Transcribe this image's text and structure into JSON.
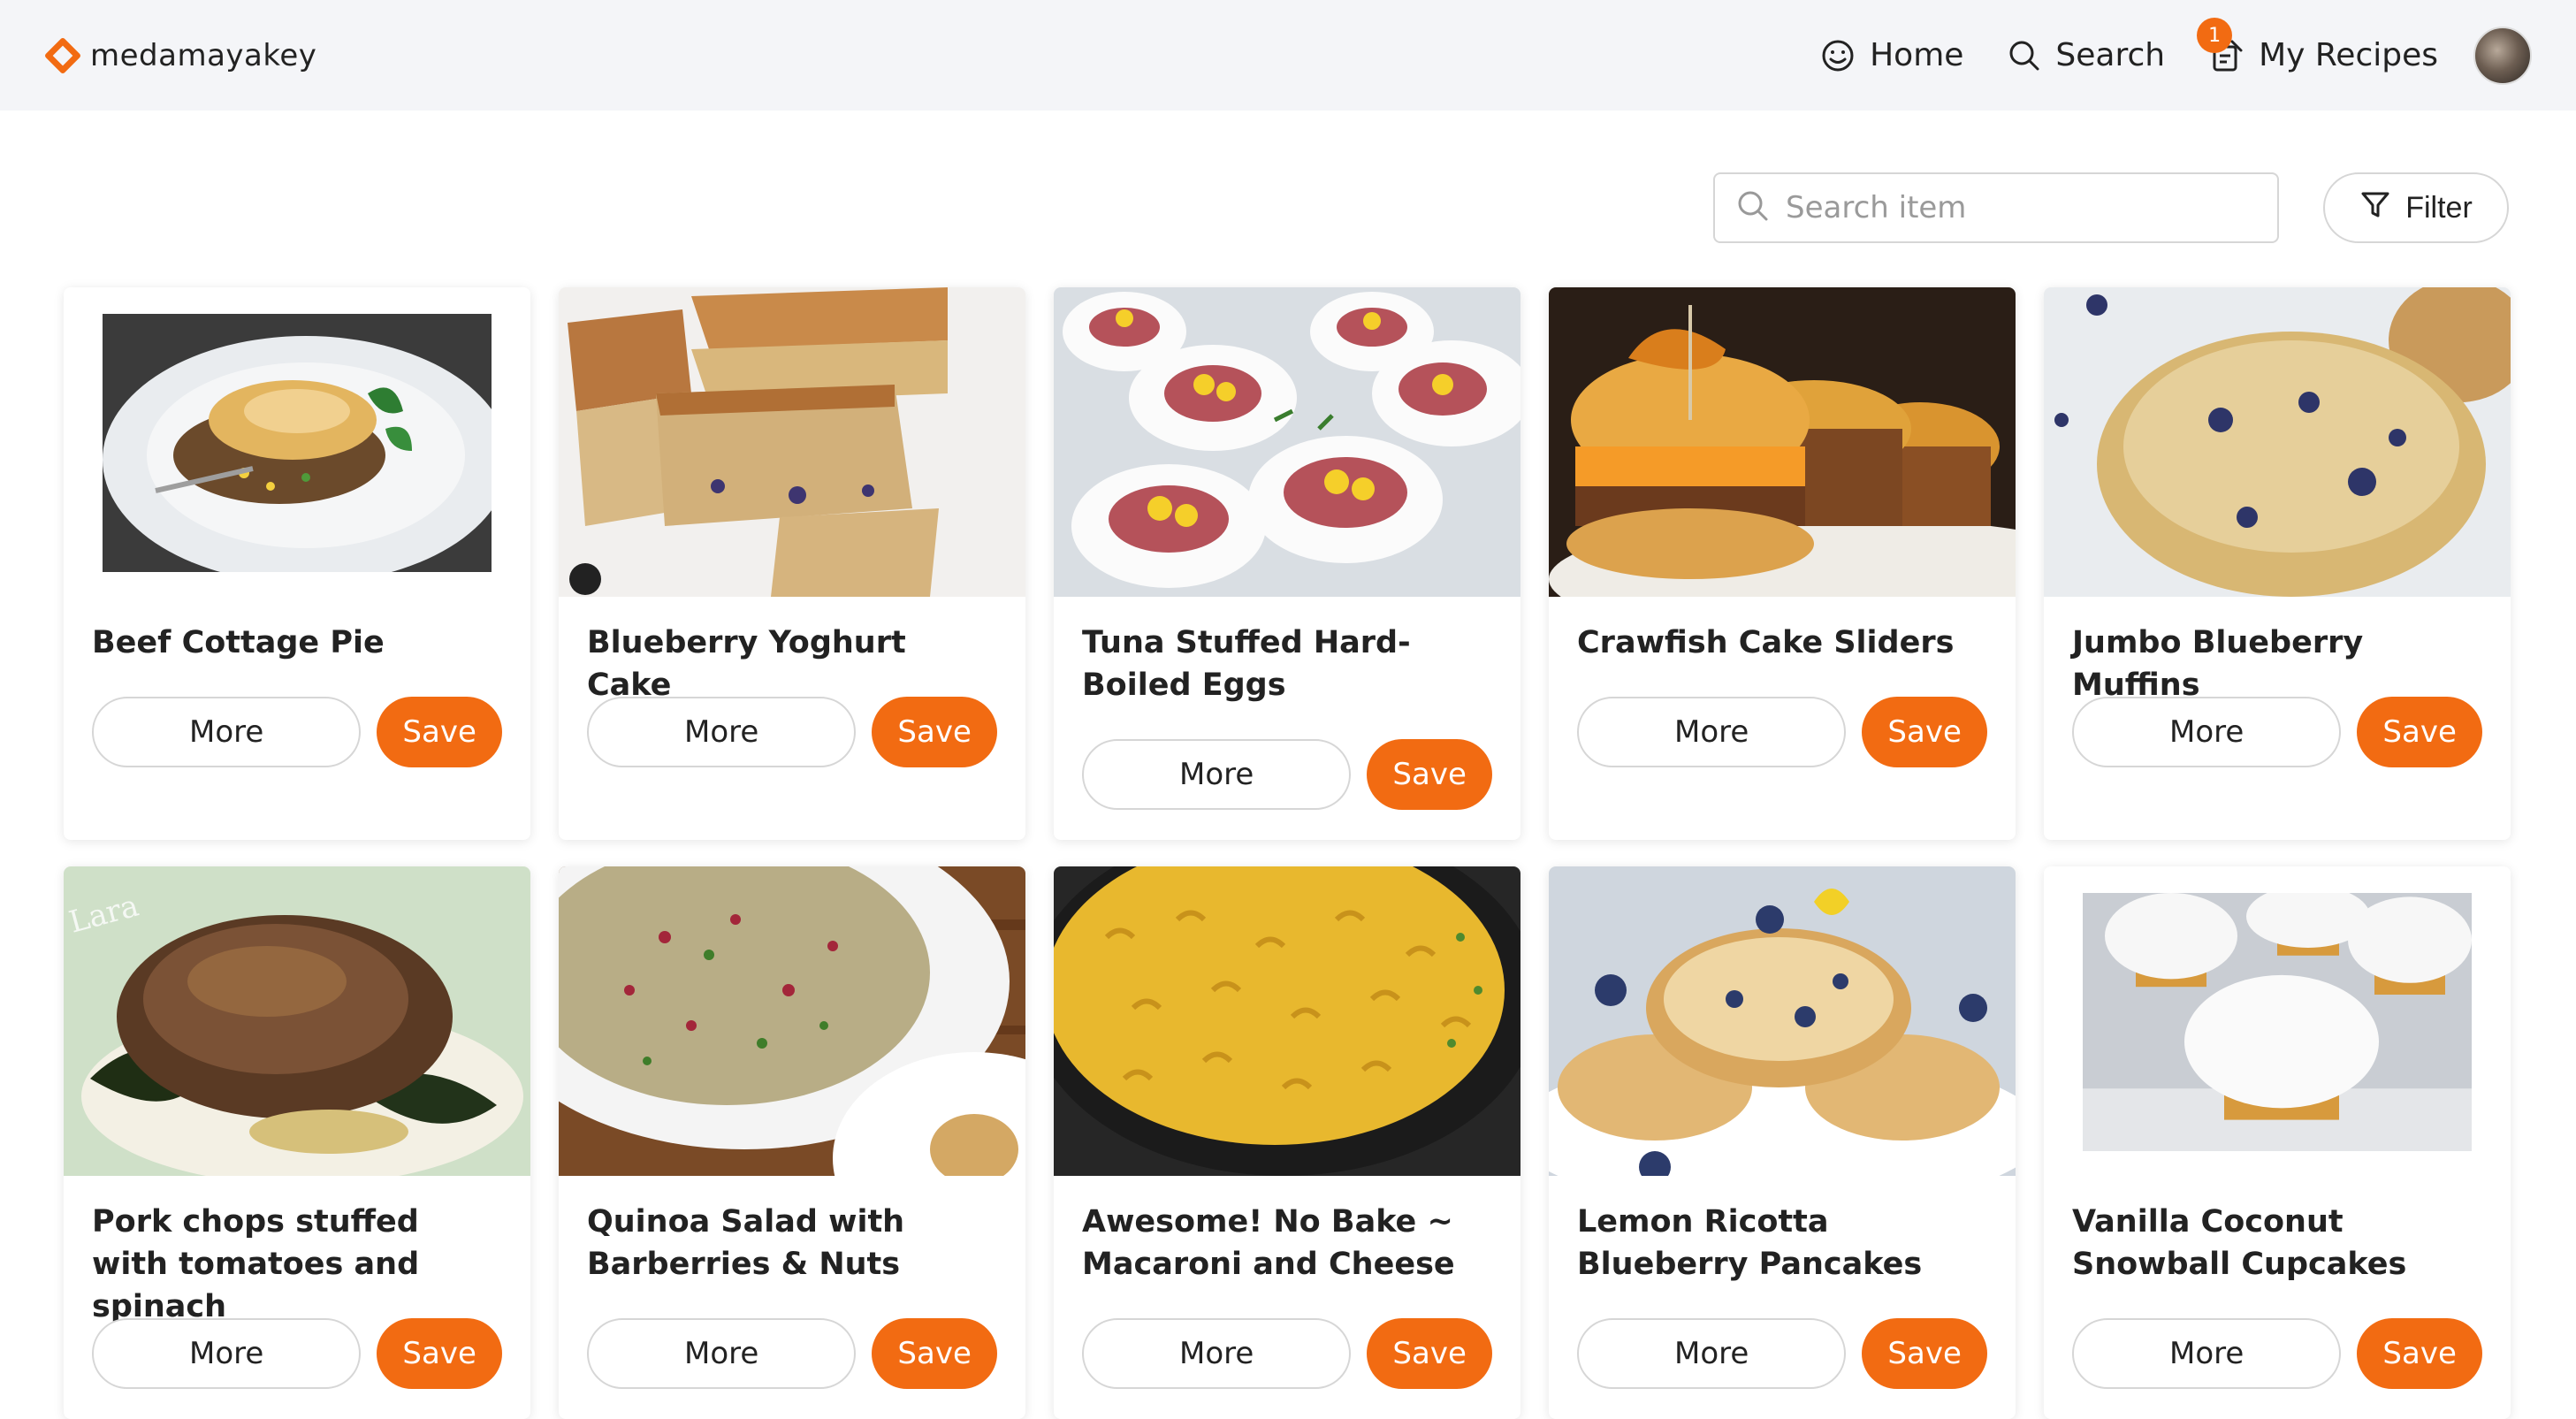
{
  "brand": {
    "name": "medamayakey",
    "accent": "#f26b12"
  },
  "nav": {
    "home": "Home",
    "search": "Search",
    "my_recipes": "My Recipes",
    "my_recipes_badge": "1"
  },
  "toolbar": {
    "search_placeholder": "Search item",
    "filter_label": "Filter"
  },
  "buttons": {
    "more": "More",
    "save": "Save"
  },
  "recipes": [
    {
      "title": "Beef Cottage Pie",
      "image": "cottage-pie"
    },
    {
      "title": "Blueberry Yoghurt Cake",
      "image": "yoghurt-cake"
    },
    {
      "title": "Tuna Stuffed Hard-Boiled Eggs",
      "image": "stuffed-eggs"
    },
    {
      "title": "Crawfish Cake Sliders",
      "image": "sliders"
    },
    {
      "title": "Jumbo Blueberry Muffins",
      "image": "muffin"
    },
    {
      "title": "Pork chops stuffed with tomatoes and spinach",
      "image": "pork-chops"
    },
    {
      "title": "Quinoa Salad with Barberries & Nuts",
      "image": "quinoa-salad"
    },
    {
      "title": "Awesome! No Bake ~ Macaroni and Cheese",
      "image": "mac-and-cheese"
    },
    {
      "title": "Lemon Ricotta Blueberry Pancakes",
      "image": "pancakes"
    },
    {
      "title": "Vanilla Coconut Snowball Cupcakes",
      "image": "cupcakes"
    }
  ]
}
